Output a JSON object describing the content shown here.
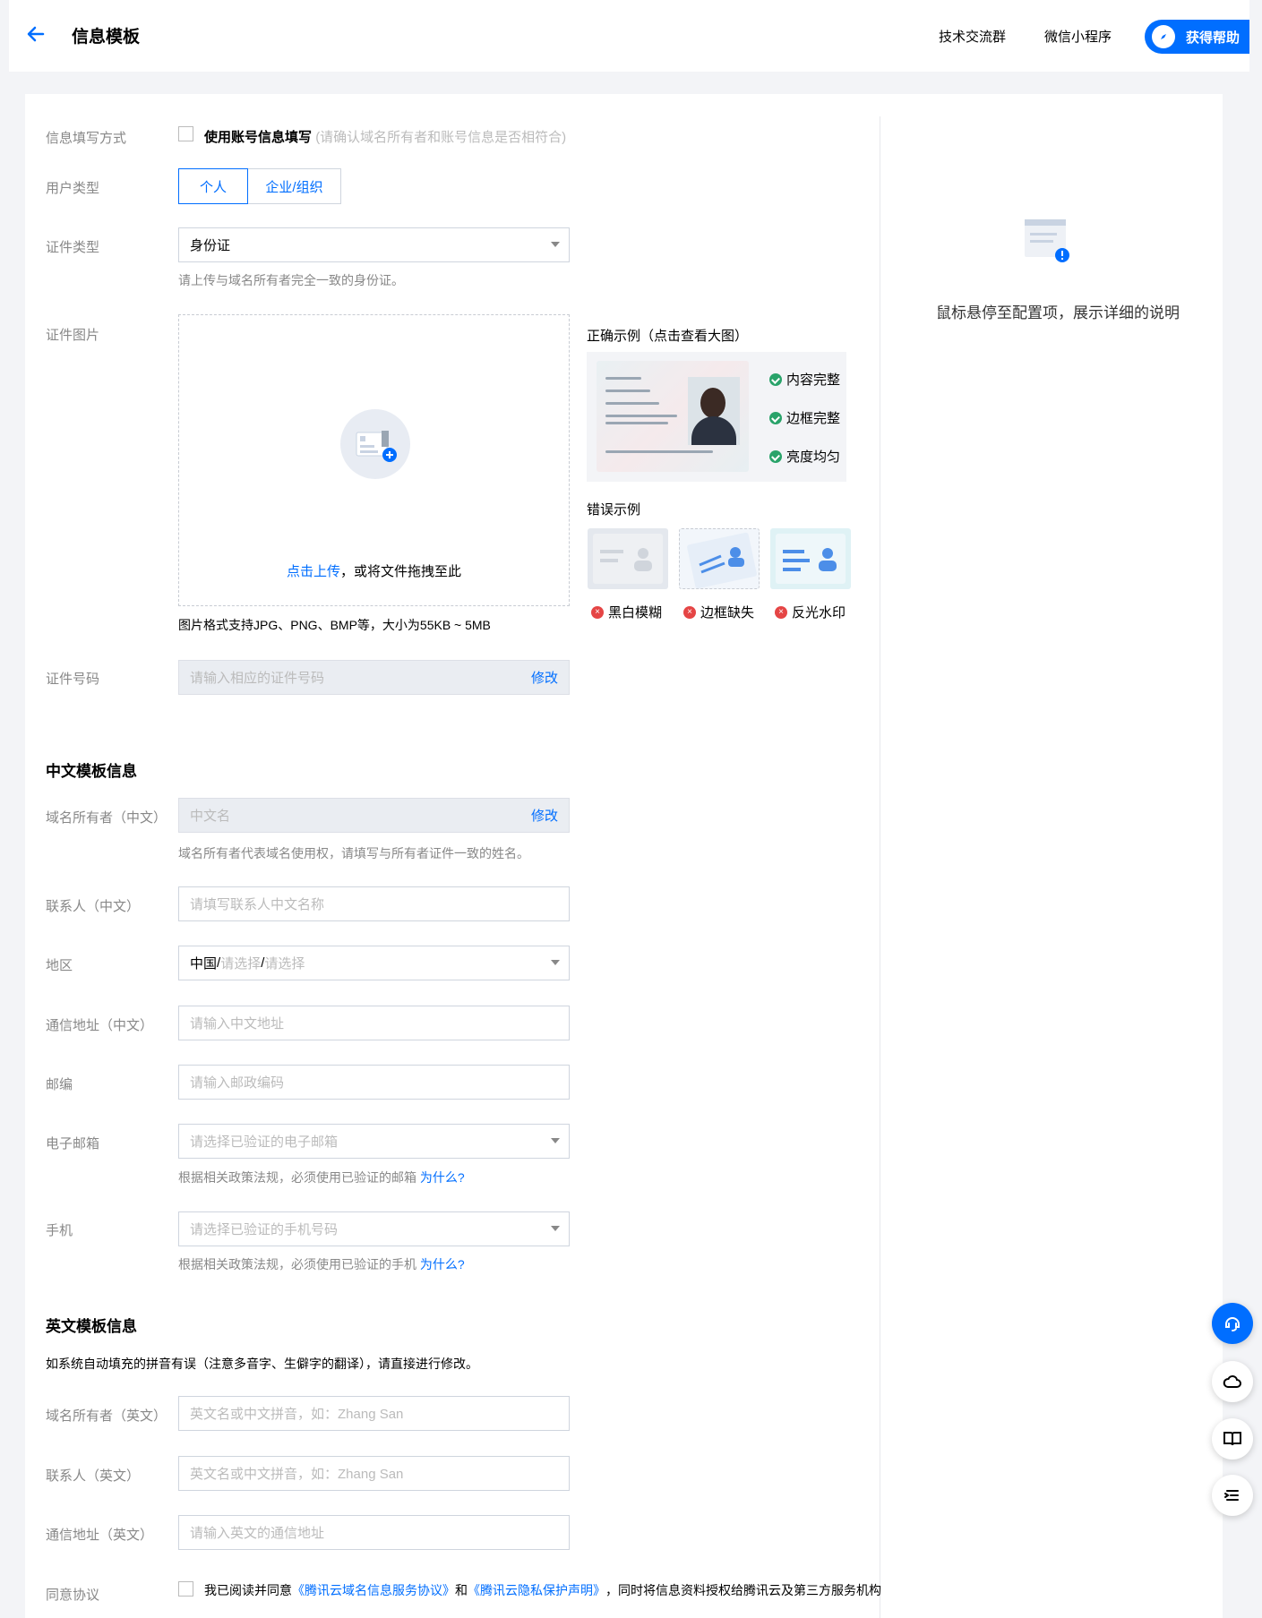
{
  "header": {
    "title": "信息模板",
    "links": [
      "技术交流群",
      "微信小程序"
    ],
    "help_label": "获得帮助"
  },
  "form": {
    "fill_method": {
      "label": "信息填写方式",
      "checkbox_label": "使用账号信息填写",
      "checkbox_note": "(请确认域名所有者和账号信息是否相符合)"
    },
    "user_type": {
      "label": "用户类型",
      "options": [
        "个人",
        "企业/组织"
      ],
      "selected": "个人"
    },
    "id_type": {
      "label": "证件类型",
      "value": "身份证",
      "hint": "请上传与域名所有者完全一致的身份证。"
    },
    "id_image": {
      "label": "证件图片",
      "upload_link": "点击上传",
      "upload_text": "，或将文件拖拽至此",
      "format_hint": "图片格式支持JPG、PNG、BMP等，大小为55KB ~ 5MB",
      "good_example_title": "正确示例（点击查看大图）",
      "good_items": [
        "内容完整",
        "边框完整",
        "亮度均匀"
      ],
      "bad_example_title": "错误示例",
      "bad_items": [
        "黑白模糊",
        "边框缺失",
        "反光水印"
      ]
    },
    "id_number": {
      "label": "证件号码",
      "placeholder": "请输入相应的证件号码",
      "edit": "修改"
    }
  },
  "cn_section": {
    "title": "中文模板信息",
    "owner": {
      "label": "域名所有者（中文）",
      "placeholder": "中文名",
      "edit": "修改",
      "hint": "域名所有者代表域名使用权，请填写与所有者证件一致的姓名。"
    },
    "contact": {
      "label": "联系人（中文）",
      "placeholder": "请填写联系人中文名称"
    },
    "region": {
      "label": "地区",
      "country": "中国",
      "sep": " / ",
      "placeholder1": "请选择",
      "placeholder2": "请选择"
    },
    "address": {
      "label": "通信地址（中文）",
      "placeholder": "请输入中文地址"
    },
    "zipcode": {
      "label": "邮编",
      "placeholder": "请输入邮政编码"
    },
    "email": {
      "label": "电子邮箱",
      "placeholder": "请选择已验证的电子邮箱",
      "hint": "根据相关政策法规，必须使用已验证的邮箱",
      "why": "为什么?"
    },
    "phone": {
      "label": "手机",
      "placeholder": "请选择已验证的手机号码",
      "hint": "根据相关政策法规，必须使用已验证的手机",
      "why": "为什么?"
    }
  },
  "en_section": {
    "title": "英文模板信息",
    "note": "如系统自动填充的拼音有误（注意多音字、生僻字的翻译），请直接进行修改。",
    "owner": {
      "label": "域名所有者（英文）",
      "placeholder": "英文名或中文拼音，如：Zhang San"
    },
    "contact": {
      "label": "联系人（英文）",
      "placeholder": "英文名或中文拼音，如：Zhang San"
    },
    "address": {
      "label": "通信地址（英文）",
      "placeholder": "请输入英文的通信地址"
    }
  },
  "agreement": {
    "label": "同意协议",
    "prefix": "我已阅读并同意",
    "link1": "《腾讯云域名信息服务协议》",
    "and": "和",
    "link2": "《腾讯云隐私保护声明》",
    "suffix": "，同时将信息资料授权给腾讯云及第三方服务机构"
  },
  "side": {
    "tip": "鼠标悬停至配置项，展示详细的说明"
  },
  "colors": {
    "primary": "#006eff",
    "success": "#29a36a",
    "error": "#e54545"
  }
}
